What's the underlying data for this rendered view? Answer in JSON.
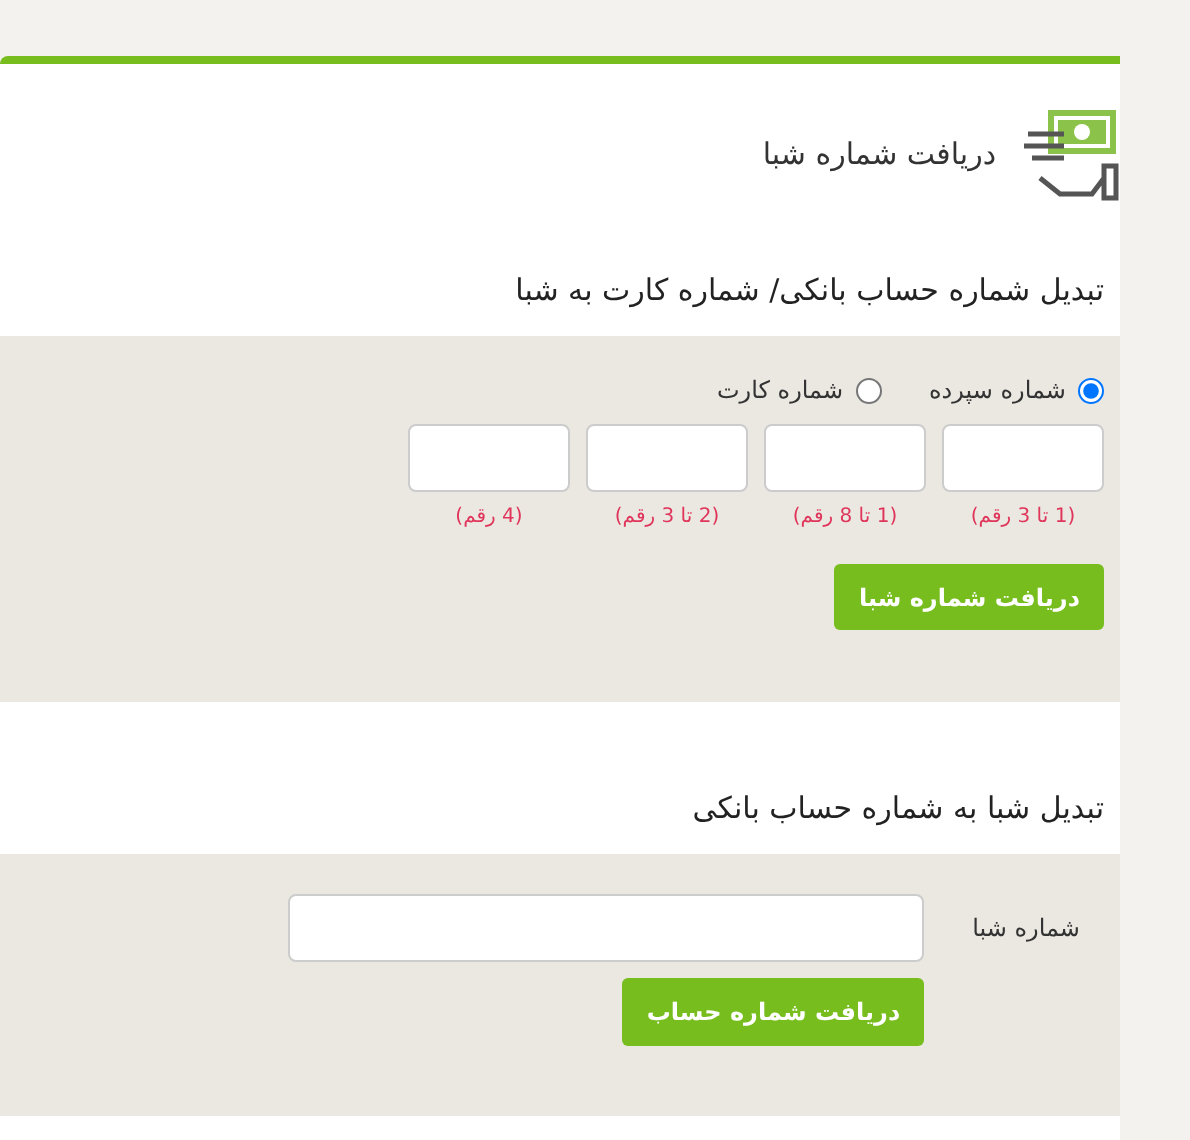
{
  "header": {
    "title": "دریافت شماره شبا"
  },
  "sections": [
    {
      "kind": "account",
      "title": "تبدیل شماره حساب بانکی/ شماره کارت به شبا",
      "options": [
        {
          "label": "شماره سپرده",
          "selected": true
        },
        {
          "label": "شماره کارت",
          "selected": false
        }
      ],
      "fields": [
        {
          "hint": "(1 تا 3 رقم)"
        },
        {
          "hint": "(1 تا 8 رقم)"
        },
        {
          "hint": "(2 تا 3 رقم)"
        },
        {
          "hint": "(4 رقم)"
        }
      ],
      "button": "دریافت شماره شبا"
    },
    {
      "kind": "sheba",
      "title": "تبدیل شبا به شماره حساب بانکی",
      "label": "شماره شبا",
      "button": "دریافت شماره حساب"
    }
  ]
}
